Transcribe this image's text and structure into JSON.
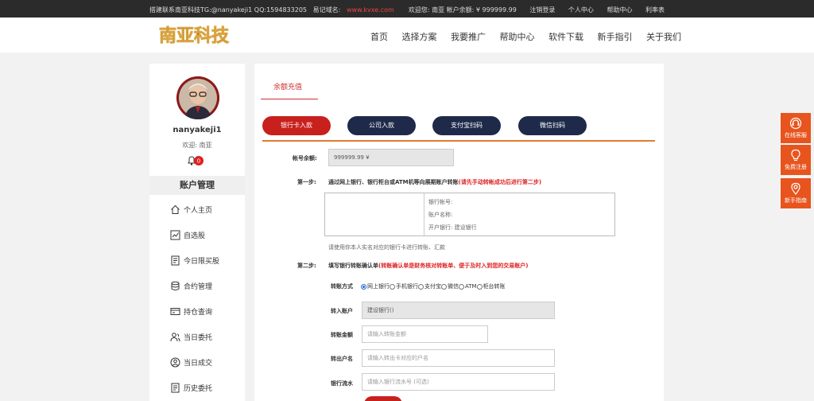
{
  "topbar": {
    "left_text": "搭建联系南亚科技TG:@nanyakeji1 QQ:1594833205",
    "domain_label": "易记域名:",
    "domain_value": "www.kvxe.com",
    "right_items": [
      "欢迎您: 南亚 帐户余额: ¥ 999999.99",
      "注销登录",
      "个人中心",
      "帮助中心",
      "利率表"
    ]
  },
  "header": {
    "logo_text": "南亚科技",
    "nav": [
      "首页",
      "选择方案",
      "我要推广",
      "帮助中心",
      "软件下载",
      "新手指引",
      "关于我们"
    ]
  },
  "sidebar": {
    "username": "nanyakeji1",
    "welcome": "欢迎: 南亚",
    "notification_count": "0",
    "section_title": "账户管理",
    "items": [
      {
        "label": "个人主页",
        "icon": "home-icon"
      },
      {
        "label": "自选股",
        "icon": "chart-icon"
      },
      {
        "label": "今日限买股",
        "icon": "document-icon"
      },
      {
        "label": "合约管理",
        "icon": "database-icon"
      },
      {
        "label": "持仓查询",
        "icon": "card-icon"
      },
      {
        "label": "当日委托",
        "icon": "users-icon"
      },
      {
        "label": "当日成交",
        "icon": "user-circle-icon"
      },
      {
        "label": "历史委托",
        "icon": "document-icon"
      }
    ]
  },
  "main": {
    "tab_title": "余额充值",
    "buttons": [
      "银行卡入款",
      "公司入款",
      "支付宝扫码",
      "微信扫码"
    ],
    "balance_label": "帐号余额:",
    "balance_value": "999999.99 ¥",
    "step1_label": "第一步:",
    "step1_text": "通过网上银行、银行柜台或ATM机等向展期账户转账",
    "step1_note": "(请先手动转帐成功后进行第二步)",
    "bank_lines": [
      "银行帐号:",
      "账户名称:",
      "开户银行: 建设银行"
    ],
    "step1_hint": "请使用你本人实名对应的银行卡进行转账、汇款",
    "step2_label": "第二步:",
    "step2_text": "填写银行转账确认单",
    "step2_note": "(转账确认单是财务核对转账单、便于及时入到您的交易账户)",
    "method_label": "转账方式",
    "methods": [
      "网上银行",
      "手机银行",
      "支付宝",
      "微信",
      "ATM",
      "柜台转账"
    ],
    "to_account_label": "转入账户",
    "to_account_value": "建设银行()",
    "amount_label": "转账金额",
    "amount_placeholder": "请输入转账金额",
    "payer_label": "转出户名",
    "payer_placeholder": "请输入转出卡对应的户名",
    "serial_label": "银行流水",
    "serial_placeholder": "请输入银行流水号 (可选)"
  },
  "float_buttons": [
    "在线客服",
    "免费注册",
    "新手指南"
  ],
  "colors": {
    "accent": "#c8201c",
    "dark_button": "#1f2a4a",
    "orange": "#e8541d"
  }
}
